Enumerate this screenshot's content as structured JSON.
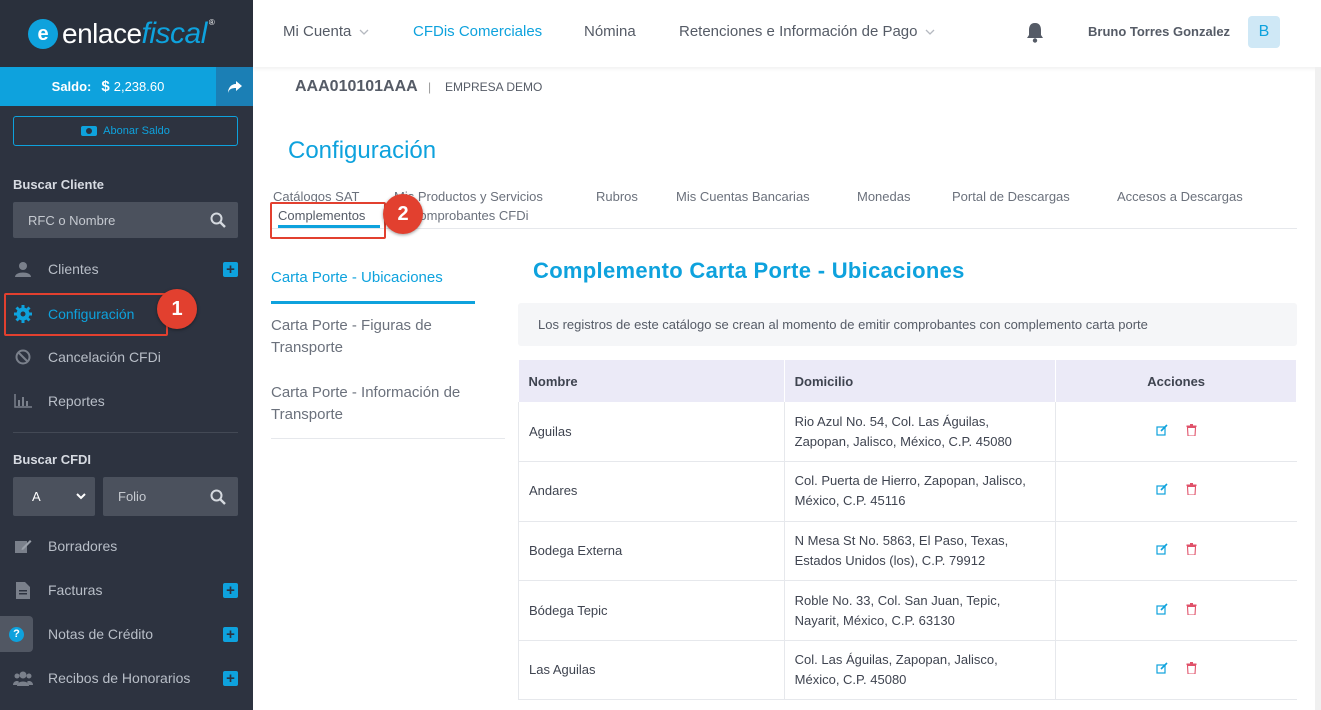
{
  "brand": {
    "logo_part1": "enlace",
    "logo_part2": "fiscal",
    "logo_reg": "®"
  },
  "saldo": {
    "label": "Saldo:",
    "currency": "$",
    "amount": "2,238.60"
  },
  "abonar_label": "Abonar Saldo",
  "buscar_cliente": {
    "title": "Buscar Cliente",
    "placeholder": "RFC o Nombre"
  },
  "sidebar": {
    "clientes": "Clientes",
    "configuracion": "Configuración",
    "cancelacion": "Cancelación CFDi",
    "reportes": "Reportes",
    "buscar_cfdi": "Buscar CFDI",
    "serie_value": "A",
    "folio_placeholder": "Folio",
    "borradores": "Borradores",
    "facturas": "Facturas",
    "notas_credito": "Notas de Crédito",
    "recibos_honorarios": "Recibos de Honorarios"
  },
  "callouts": {
    "one": "1",
    "two": "2"
  },
  "topnav": {
    "mi_cuenta": "Mi Cuenta",
    "cfdis": "CFDis Comerciales",
    "nomina": "Nómina",
    "retenciones": "Retenciones e Información de Pago",
    "user": "Bruno Torres Gonzalez",
    "avatar": "B"
  },
  "company": {
    "rfc": "AAA010101AAA",
    "separator": "|",
    "name": "EMPRESA DEMO"
  },
  "page_title": "Configuración",
  "tabs": [
    "Catálogos SAT",
    "Mis Productos y Servicios",
    "Rubros",
    "Mis Cuentas Bancarias",
    "Monedas",
    "Portal de Descargas",
    "Accesos a Descargas",
    "Complementos",
    "Comprobantes CFDi"
  ],
  "subnav": [
    "Carta Porte - Ubicaciones",
    "Carta Porte - Figuras de Transporte",
    "Carta Porte - Información de Transporte"
  ],
  "section": {
    "heading": "Complemento Carta Porte - Ubicaciones",
    "info": "Los registros de este catálogo se crean al momento de emitir comprobantes con complemento carta porte"
  },
  "table": {
    "headers": [
      "Nombre",
      "Domicilio",
      "Acciones"
    ],
    "rows": [
      {
        "nombre": "Aguilas",
        "domicilio_l1": "Rio Azul No. 54, Col. Las Águilas,",
        "domicilio_l2": "Zapopan, Jalisco, México, C.P. 45080"
      },
      {
        "nombre": "Andares",
        "domicilio_l1": "Col. Puerta de Hierro, Zapopan, Jalisco,",
        "domicilio_l2": "México, C.P. 45116"
      },
      {
        "nombre": "Bodega Externa",
        "domicilio_l1": "N Mesa St No. 5863, El Paso, Texas,",
        "domicilio_l2": "Estados Unidos (los), C.P. 79912"
      },
      {
        "nombre": "Bódega Tepic",
        "domicilio_l1": "Roble No. 33, Col. San Juan, Tepic,",
        "domicilio_l2": "Nayarit, México, C.P. 63130"
      },
      {
        "nombre": "Las Aguilas",
        "domicilio_l1": "Col. Las Águilas, Zapopan, Jalisco,",
        "domicilio_l2": "México, C.P. 45080"
      }
    ]
  },
  "colors": {
    "accent": "#0ea2dd",
    "sidebar": "#2d3340",
    "callout": "#e2402f",
    "delete": "#e0526a"
  },
  "icons": [
    "user-icon",
    "gear-icon",
    "ban-icon",
    "chart-icon",
    "draft-icon",
    "file-icon",
    "help-icon",
    "users-icon",
    "bell-icon",
    "search-icon",
    "edit-icon",
    "trash-icon",
    "share-icon",
    "cash-icon",
    "chevron-down-icon"
  ]
}
